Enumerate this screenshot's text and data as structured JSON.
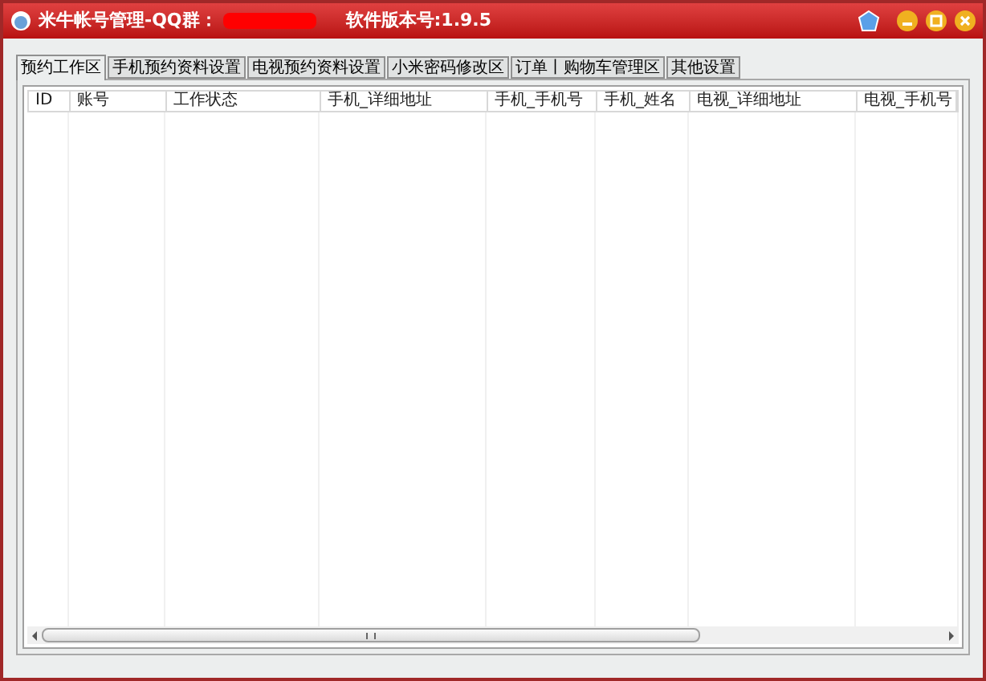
{
  "window": {
    "title": "米牛帐号管理-QQ群：",
    "version": "软件版本号:1.9.5"
  },
  "tabs": [
    {
      "label": "预约工作区",
      "selected": true
    },
    {
      "label": "手机预约资料设置",
      "selected": false
    },
    {
      "label": "电视预约资料设置",
      "selected": false
    },
    {
      "label": "小米密码修改区",
      "selected": false
    },
    {
      "label": "订单丨购物车管理区",
      "selected": false
    },
    {
      "label": "其他设置",
      "selected": false
    }
  ],
  "table": {
    "columns": [
      "ID",
      "账号",
      "工作状态",
      "手机_详细地址",
      "手机_手机号",
      "手机_姓名",
      "电视_详细地址",
      "电视_手机号"
    ]
  }
}
